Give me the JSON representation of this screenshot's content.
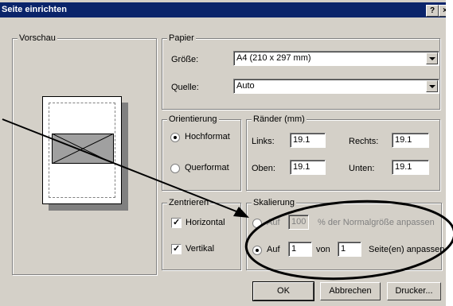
{
  "window": {
    "title": "Seite einrichten",
    "help_label": "?",
    "close_label": "×"
  },
  "preview": {
    "legend": "Vorschau"
  },
  "paper": {
    "legend": "Papier",
    "size_label": "Größe:",
    "size_value": "A4 (210 x 297 mm)",
    "source_label": "Quelle:",
    "source_value": "Auto"
  },
  "orientation": {
    "legend": "Orientierung",
    "portrait": "Hochformat",
    "landscape": "Querformat",
    "selected": "portrait"
  },
  "margins": {
    "legend": "Ränder (mm)",
    "left_label": "Links:",
    "left": "19.1",
    "right_label": "Rechts:",
    "right": "19.1",
    "top_label": "Oben:",
    "top": "19.1",
    "bottom_label": "Unten:",
    "bottom": "19.1"
  },
  "center": {
    "legend": "Zentrieren",
    "horizontal": "Horizontal",
    "vertical": "Vertikal"
  },
  "scaling": {
    "legend": "Skalierung",
    "auf_label": "Auf",
    "percent_value": "100",
    "percent_suffix": "% der Normalgröße anpassen",
    "fit_auf_label": "Auf",
    "fit_wide": "1",
    "von_label": "von",
    "fit_tall": "1",
    "pages_suffix": "Seite(en) anpassen"
  },
  "buttons": {
    "ok": "OK",
    "cancel": "Abbrechen",
    "printer": "Drucker..."
  },
  "annotation": {
    "color": "#000000"
  }
}
